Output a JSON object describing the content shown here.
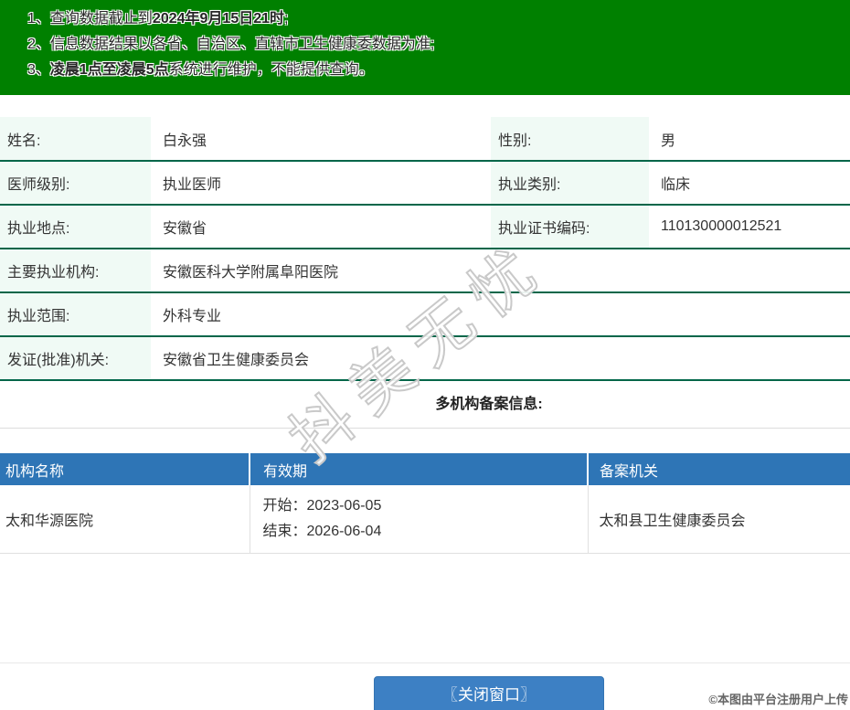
{
  "notice": {
    "lines": [
      {
        "num": "1、",
        "pre": "查询数据截止到",
        "bold": "2024年9月15日21时",
        "post": ";"
      },
      {
        "num": "2、",
        "pre": "信息数据结果以各省、自治区、直辖市卫生健康委数据为准;",
        "bold": "",
        "post": ""
      },
      {
        "num": "3、",
        "pre": "",
        "bold": "凌晨1点至凌晨5点",
        "post": "系统进行维护，不能提供查询。"
      }
    ]
  },
  "doctor": {
    "rows2col": [
      {
        "label1": "姓名:",
        "value1": "白永强",
        "label2": "性别:",
        "value2": "男"
      },
      {
        "label1": "医师级别:",
        "value1": "执业医师",
        "label2": "执业类别:",
        "value2": "临床"
      },
      {
        "label1": "执业地点:",
        "value1": "安徽省",
        "label2": "执业证书编码:",
        "value2": "110130000012521"
      }
    ],
    "rows1col": [
      {
        "label": "主要执业机构:",
        "value": "安徽医科大学附属阜阳医院"
      },
      {
        "label": "执业范围:",
        "value": "外科专业"
      },
      {
        "label": "发证(批准)机关:",
        "value": "安徽省卫生健康委员会"
      }
    ]
  },
  "filing": {
    "section_title": "多机构备案信息:",
    "headers": [
      "机构名称",
      "有效期",
      "备案机关"
    ],
    "rows": [
      {
        "org": "太和华源医院",
        "start": "开始：2023-06-05",
        "end": "结束：2026-06-04",
        "authority": "太和县卫生健康委员会"
      }
    ]
  },
  "footer": {
    "close_button": "〖关闭窗口〗",
    "copyright": "©本图由平台注册用户上传"
  },
  "watermark": "抖美无忧",
  "colors": {
    "notice_bg": "#008000",
    "row_border_green": "#006649",
    "label_bg": "#f0faf5",
    "header_blue": "#2e75b6",
    "button_blue": "#3d80c4"
  }
}
